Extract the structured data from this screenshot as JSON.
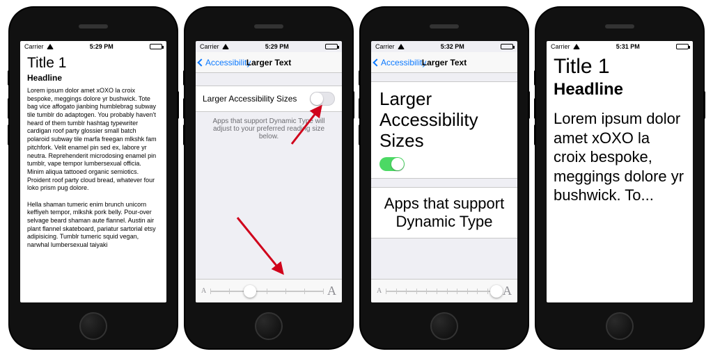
{
  "status": {
    "carrier": "Carrier",
    "times": [
      "5:29 PM",
      "5:29 PM",
      "5:32 PM",
      "5:31 PM"
    ]
  },
  "nav": {
    "back_label": "Accessibility",
    "title": "Larger Text"
  },
  "settings": {
    "toggle_label": "Larger Accessibility Sizes",
    "toggle_label_multiline": "Larger\nAccessibility\nSizes",
    "toggle_on_phone2": false,
    "toggle_on_phone3": true,
    "helper_text": "Apps that support Dynamic Type will adjust to your preferred reading size below.",
    "helper_text_short": "Apps that support Dynamic Type",
    "slider": {
      "small_glyph": "A",
      "big_glyph": "A",
      "value_phone2": 0.35,
      "value_phone3": 0.98
    }
  },
  "sample": {
    "title": "Title 1",
    "headline": "Headline",
    "body_small": "Lorem ipsum dolor amet xOXO la croix bespoke, meggings dolore yr bushwick. Tote bag vice affogato jianbing humblebrag subway tile tumblr do adaptogen. You probably haven't heard of them tumblr hashtag typewriter cardigan roof party glossier small batch polaroid subway tile marfa freegan mlkshk fam pitchfork. Velit enamel pin sed ex, labore yr neutra. Reprehenderit microdosing enamel pin tumblr, vape tempor lumbersexual officia. Minim aliqua tattooed organic semiotics. Proident roof party cloud bread, whatever four loko prism pug dolore.\n\nHella shaman tumeric enim brunch unicorn keffiyeh tempor, mlkshk pork belly. Pour-over selvage beard shaman aute flannel. Austin air plant flannel skateboard, pariatur sartorial etsy adipisicing. Tumblr tumeric squid vegan, narwhal lumbersexual taiyaki",
    "body_big": "Lorem ipsum dolor amet xOXO la croix bespoke, meggings dolore yr bushwick. To..."
  },
  "colors": {
    "ios_blue": "#0b79ff",
    "ios_green": "#4cd964",
    "arrow_red": "#d0021b"
  }
}
